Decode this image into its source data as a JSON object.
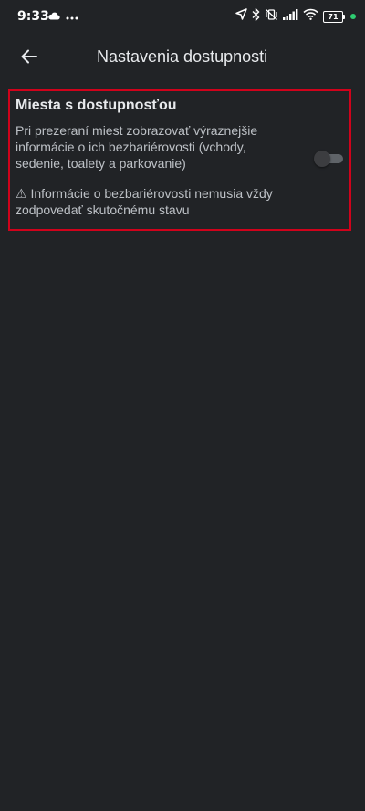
{
  "status_bar": {
    "time": "9:33",
    "battery_level": "71",
    "icons": [
      "cloud-icon",
      "more-dots-icon",
      "navigation-icon",
      "bluetooth-icon",
      "mute-vibrate-icon",
      "signal-icon",
      "wifi-icon",
      "battery-icon",
      "green-dot-indicator"
    ]
  },
  "app_bar": {
    "title": "Nastavenia dostupnosti",
    "back_icon": "arrow-left-icon"
  },
  "setting": {
    "title": "Miesta s dostupnosťou",
    "description": "Pri prezeraní miest zobrazovať výraznejšie informácie o ich bezbariérovosti (vchody, sedenie, toalety a parkovanie)",
    "warning": "⚠ Informácie o bezbariérovosti nemusia vždy zodpovedať skutočnému stavu",
    "toggle_state": "off"
  },
  "colors": {
    "background": "#212326",
    "highlight_border": "#d0021b",
    "text_primary": "#e8eaed",
    "text_secondary": "#bdc1c6",
    "status_dot": "#2ecc71"
  }
}
